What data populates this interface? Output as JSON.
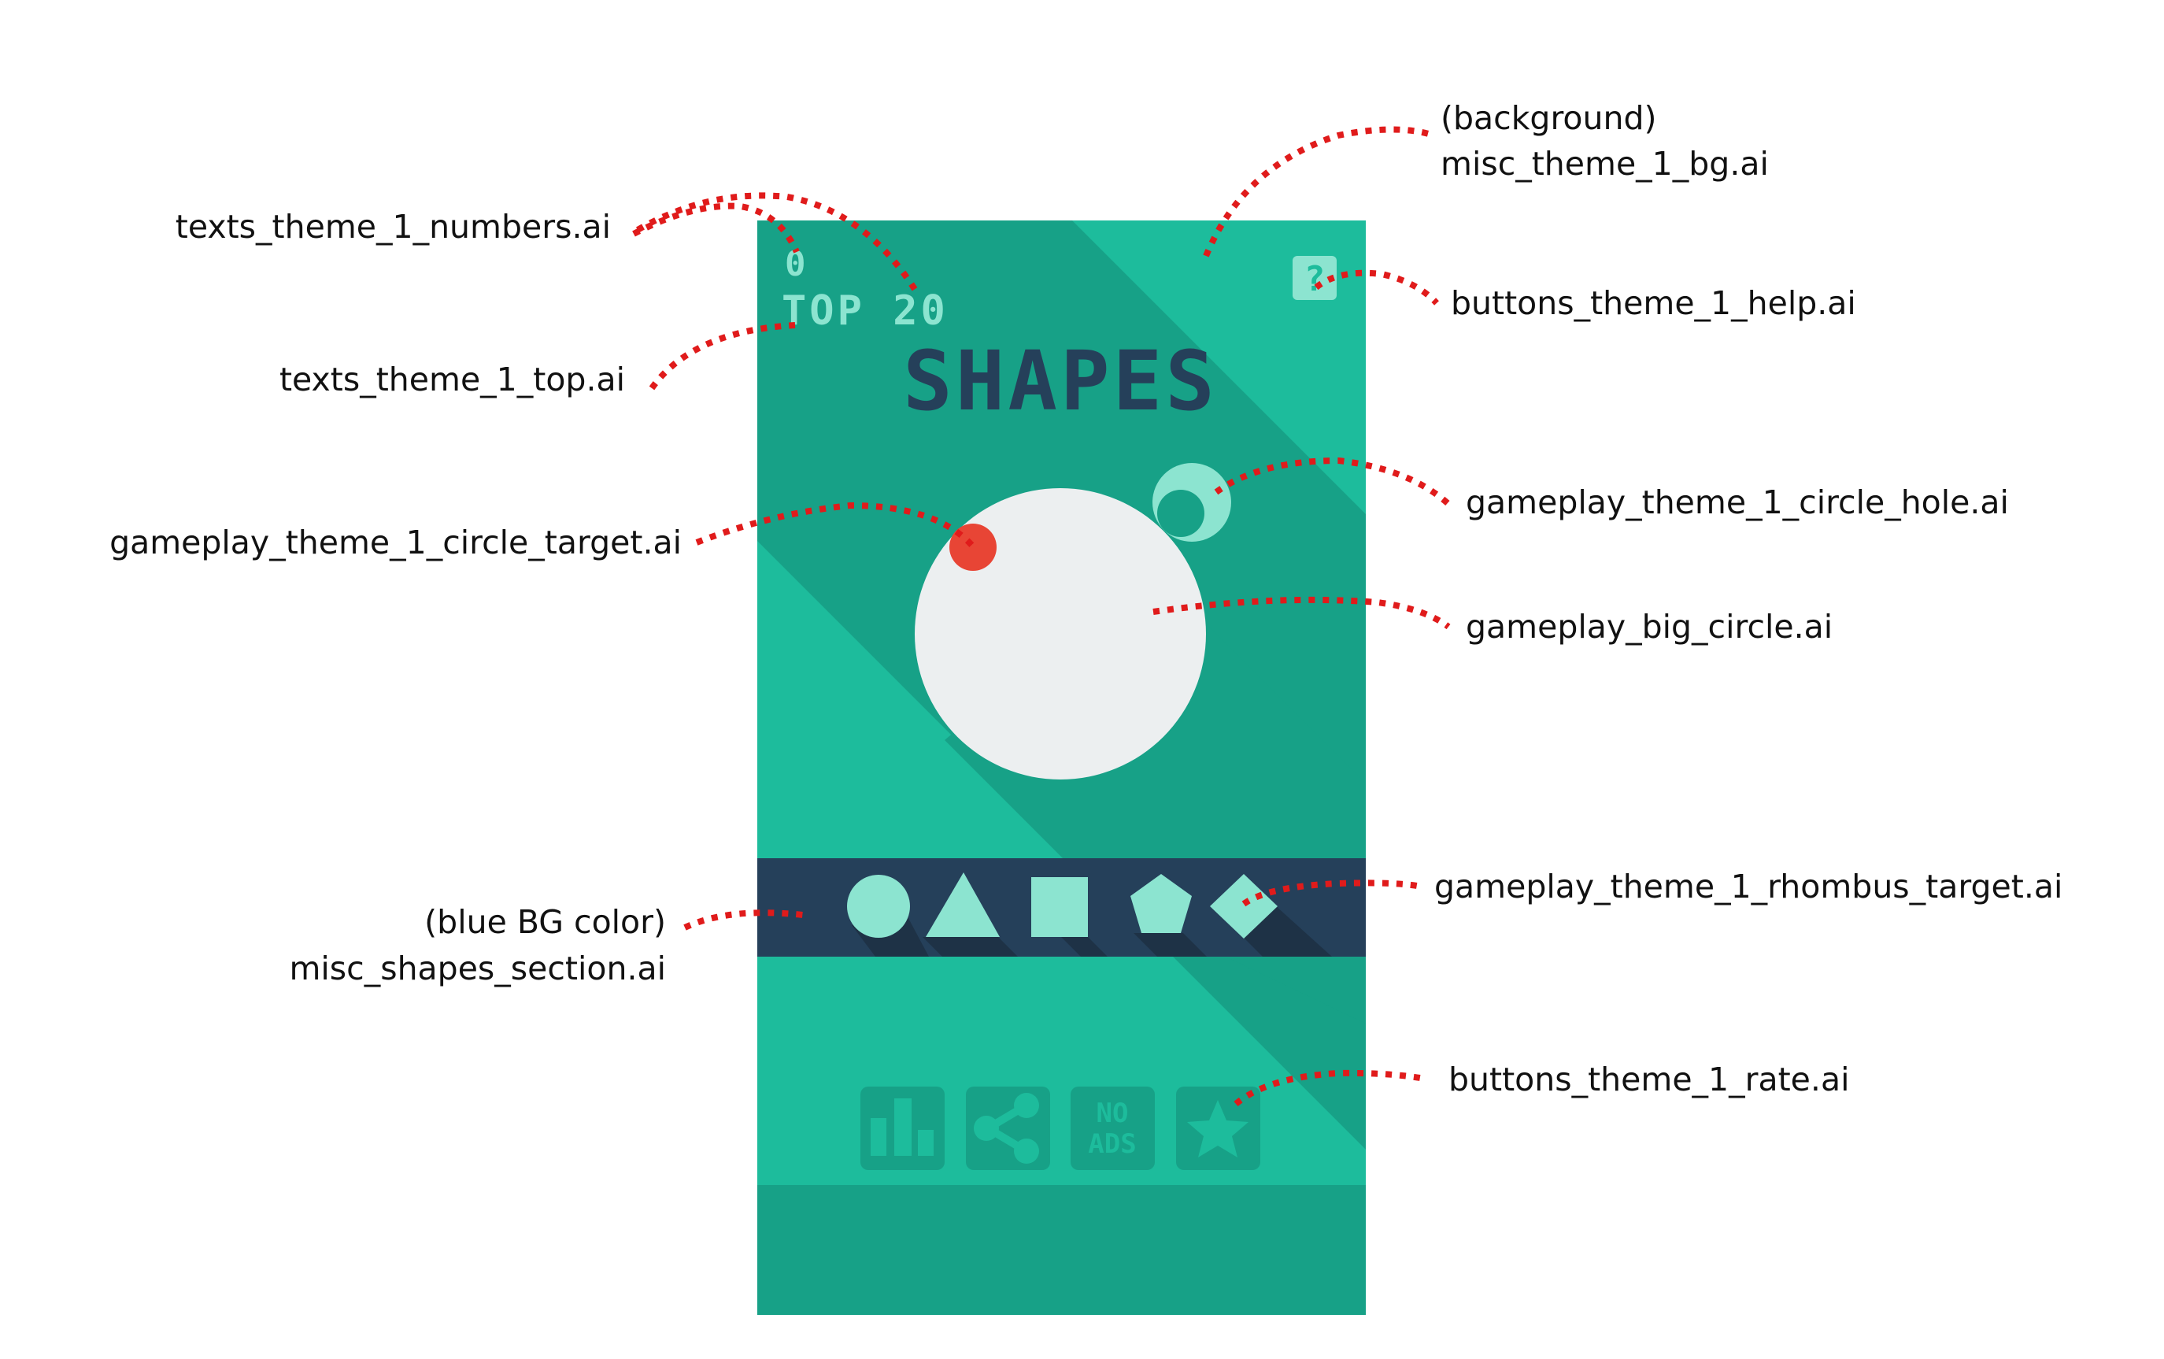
{
  "game": {
    "score": "0",
    "top_label": "TOP 20",
    "title": "SHAPES",
    "help_glyph": "?",
    "shapes_bar": [
      "circle",
      "triangle",
      "square",
      "pentagon",
      "rhombus"
    ],
    "buttons": [
      {
        "name": "leaderboard",
        "icon": "bar-chart-icon"
      },
      {
        "name": "share",
        "icon": "share-icon"
      },
      {
        "name": "no-ads",
        "label_line1": "NO",
        "label_line2": "ADS"
      },
      {
        "name": "rate",
        "icon": "star-icon"
      }
    ]
  },
  "annotations": {
    "numbers": "texts_theme_1_numbers.ai",
    "top": "texts_theme_1_top.ai",
    "circle_target": "gameplay_theme_1_circle_target.ai",
    "shapes_section_line1": "(blue BG color)",
    "shapes_section_line2": "misc_shapes_section.ai",
    "background_line1": "(background)",
    "background_line2": "misc_theme_1_bg.ai",
    "help": "buttons_theme_1_help.ai",
    "circle_hole": "gameplay_theme_1_circle_hole.ai",
    "big_circle": "gameplay_big_circle.ai",
    "rhombus_target": "gameplay_theme_1_rhombus_target.ai",
    "rate": "buttons_theme_1_rate.ai"
  },
  "colors": {
    "teal": "#1dbc9c",
    "shadow": "#17a187",
    "dark_navy": "#25405a",
    "mint": "#8ce4d0",
    "circle_white": "#eceff0",
    "target_red": "#e84535",
    "leader_red": "#e01b1b"
  }
}
